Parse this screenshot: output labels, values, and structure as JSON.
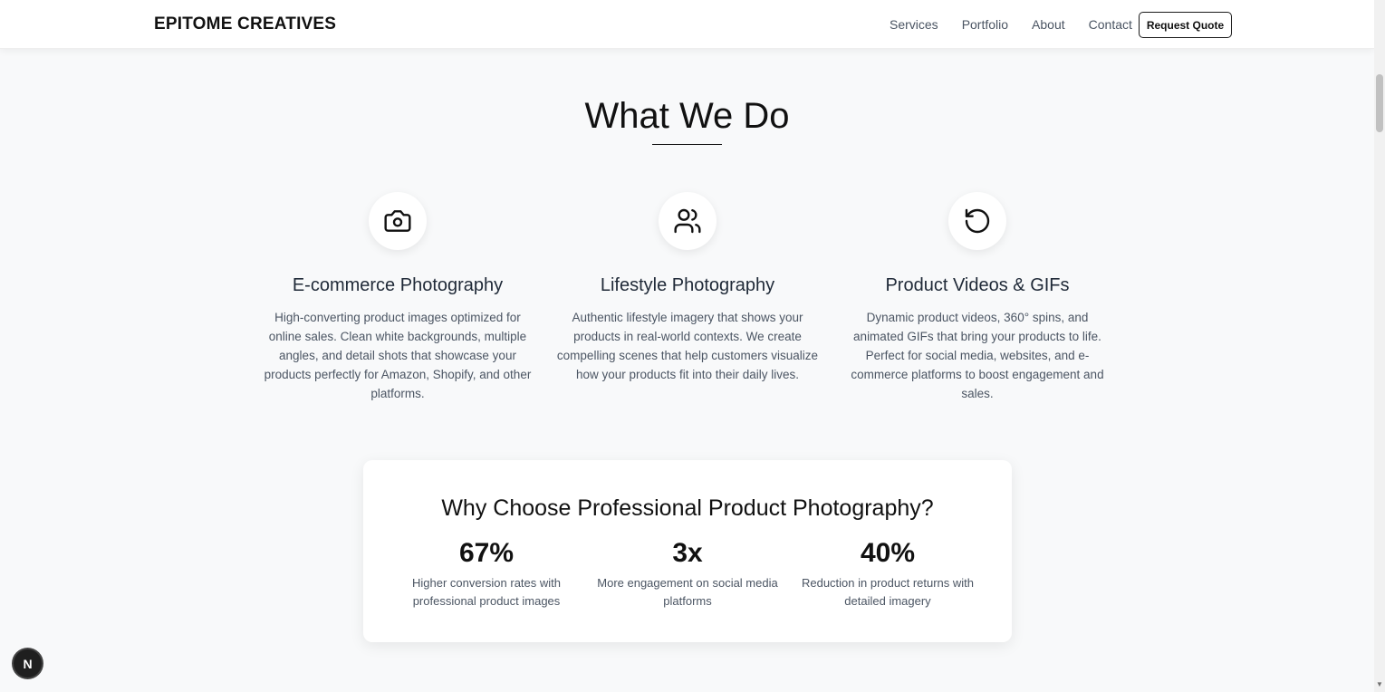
{
  "header": {
    "brand": "EPITOME CREATIVES",
    "nav": [
      "Services",
      "Portfolio",
      "About",
      "Contact"
    ],
    "cta_label": "Request Quote"
  },
  "section": {
    "title": "What We Do"
  },
  "services": [
    {
      "icon": "camera-icon",
      "title": "E-commerce Photography",
      "description": "High-converting product images optimized for online sales. Clean white backgrounds, multiple angles, and detail shots that showcase your products perfectly for Amazon, Shopify, and other platforms."
    },
    {
      "icon": "users-icon",
      "title": "Lifestyle Photography",
      "description": "Authentic lifestyle imagery that shows your products in real-world contexts. We create compelling scenes that help customers visualize how your products fit into their daily lives."
    },
    {
      "icon": "rotate-icon",
      "title": "Product Videos & GIFs",
      "description": "Dynamic product videos, 360° spins, and animated GIFs that bring your products to life. Perfect for social media, websites, and e-commerce platforms to boost engagement and sales."
    }
  ],
  "stats": {
    "title": "Why Choose Professional Product Photography?",
    "items": [
      {
        "value": "67%",
        "label": "Higher conversion rates with professional product images"
      },
      {
        "value": "3x",
        "label": "More engagement on social media platforms"
      },
      {
        "value": "40%",
        "label": "Reduction in product returns with detailed imagery"
      }
    ]
  },
  "badge": {
    "letter": "N"
  }
}
